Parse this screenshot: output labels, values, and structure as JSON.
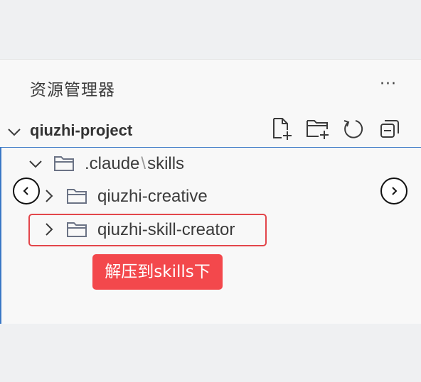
{
  "explorer": {
    "title": "资源管理器",
    "more_label": "···"
  },
  "project": {
    "name": "qiuzhi-project"
  },
  "toolbar": {
    "icons": [
      "new-file-icon",
      "new-folder-icon",
      "refresh-icon",
      "collapse-all-icon"
    ]
  },
  "tree": {
    "items": [
      {
        "label_part1": ".claude",
        "separator": "\\",
        "label_part2": "skills",
        "expanded": true
      },
      {
        "label": "qiuzhi-creative",
        "expanded": false
      },
      {
        "label": "qiuzhi-skill-creator",
        "expanded": false
      }
    ]
  },
  "annotation": {
    "text": "解压到skills下",
    "color": "#f3484c"
  },
  "colors": {
    "accent": "#3a78c6",
    "highlight": "#e3464b"
  }
}
